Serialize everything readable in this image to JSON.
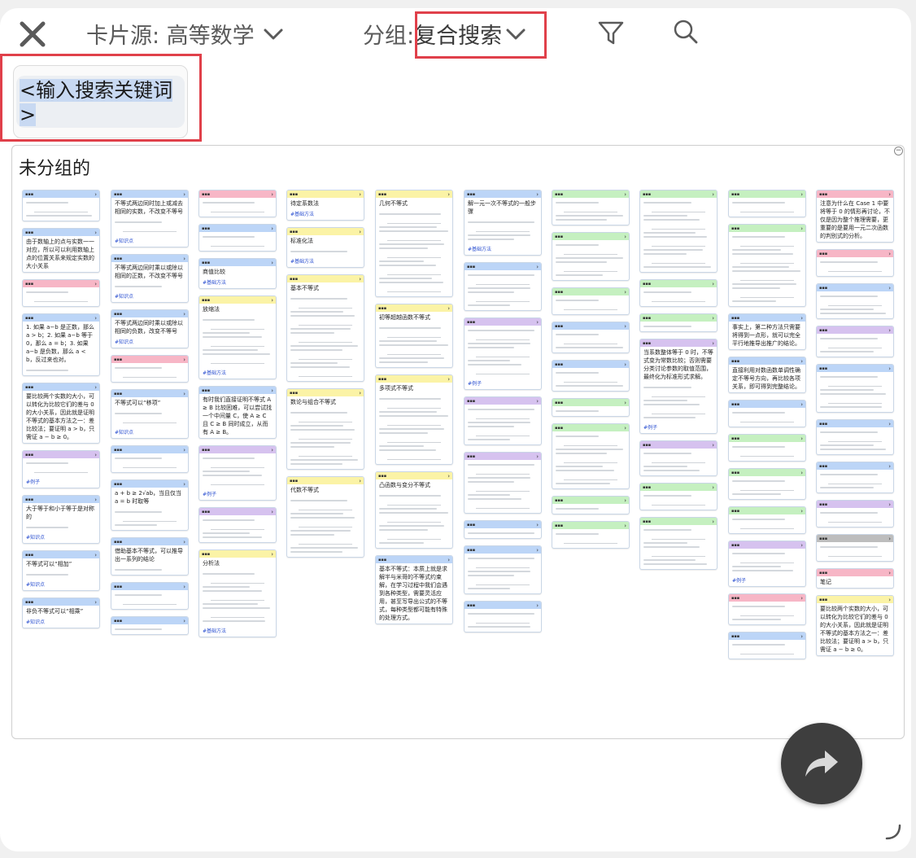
{
  "toolbar": {
    "source_label": "卡片源: 高等数学",
    "group_label": "分组:",
    "group_value": "复合搜索"
  },
  "search": {
    "keyword_placeholder": "<输入搜索关键词>"
  },
  "canvas": {
    "group_title": "未分组的"
  },
  "colors": {
    "blue": "#bcd5f7",
    "pink": "#f7b6c6",
    "yellow": "#fbf3a6",
    "green": "#c5f0c0",
    "purple": "#d6c2ef",
    "gray": "#bdbdbd",
    "accent_red": "#e0404a"
  },
  "columns": [
    {
      "cards": [
        {
          "color": "blue",
          "lines": 3
        },
        {
          "color": "blue",
          "title": "由于数轴上的点与实数一一对应，所以可以利用数轴上点的位置关系来规定实数的大小关系",
          "lines": 0
        },
        {
          "color": "pink",
          "lines": 2
        },
        {
          "color": "blue",
          "title": "1. 如果 a−b 是正数，那么 a > b；2. 如果 a−b 等于 0，那么 a = b；3. 如果 a−b 是负数，那么 a < b，反过来也对。",
          "lines": 1
        },
        {
          "color": "blue",
          "title": "要比较两个实数的大小，可以转化为比较它们的差与 0 的大小关系，因此就是证明不等式的基本方法之一：差比较法；要证明 a > b，只需证 a − b ≥ 0。",
          "tag": "",
          "lines": 0
        },
        {
          "color": "purple",
          "lines": 2,
          "tag": "#例子"
        },
        {
          "color": "blue",
          "title": "大于等于和小于等于是对称的",
          "tag": "#知识点",
          "lines": 1
        },
        {
          "color": "blue",
          "title": "不等式可以“相加”",
          "tag": "#知识点",
          "lines": 1
        },
        {
          "color": "blue",
          "title": "非负不等式可以“相乘”",
          "tag": "#知识点",
          "lines": 0
        }
      ]
    },
    {
      "cards": [
        {
          "color": "blue",
          "title": "不等式两边同时加上或减去相同的实数，不改变不等号",
          "tag": "#知识点",
          "lines": 2
        },
        {
          "color": "blue",
          "title": "不等式两边同时乘以或除以相同的正数，不改变不等号",
          "tag": "#知识点",
          "lines": 1
        },
        {
          "color": "blue",
          "title": "不等式两边同时乘以或除以相同的负数，改变不等号",
          "tag": "#知识点",
          "lines": 0
        },
        {
          "color": "pink",
          "lines": 2
        },
        {
          "color": "blue",
          "title": "不等式可以“移项”",
          "tag": "#知识点",
          "lines": 2
        },
        {
          "color": "blue",
          "lines": 2
        },
        {
          "color": "blue",
          "title": "a + b ≥ 2√ab，当且仅当 a = b 时取等",
          "tag": "",
          "lines": 3
        },
        {
          "color": "blue",
          "title": "借助基本不等式，可以推导出一系列的结论",
          "tag": "",
          "lines": 1
        },
        {
          "color": "blue",
          "lines": 2
        },
        {
          "color": "blue",
          "lines": 1
        }
      ]
    },
    {
      "cards": [
        {
          "color": "pink",
          "lines": 2
        },
        {
          "color": "blue",
          "lines": 2
        },
        {
          "color": "blue",
          "title": "商值比较",
          "tag": "#基础方法",
          "lines": 0
        },
        {
          "color": "yellow",
          "title": "放缩法",
          "tag": "#基础方法",
          "lines": 8
        },
        {
          "color": "blue",
          "title": "有时我们直接证明不等式 A ≥ B 比较困难，可以尝试找一个中间量 C，使 A ≥ C 且 C ≥ B 同时成立，从而有 A ≥ B。",
          "tag": "",
          "lines": 0
        },
        {
          "color": "purple",
          "tag": "#例子",
          "lines": 5
        },
        {
          "color": "purple",
          "lines": 4
        },
        {
          "color": "yellow",
          "title": "分析法",
          "tag": "#基础方法",
          "lines": 9
        }
      ]
    },
    {
      "cards": [
        {
          "color": "yellow",
          "title": "待定系数法",
          "tag": "#基础方法",
          "lines": 0
        },
        {
          "color": "yellow",
          "title": "标准化法",
          "tag": "#基础方法",
          "lines": 1
        },
        {
          "color": "yellow",
          "title": "基本不等式",
          "lines": 14
        },
        {
          "color": "yellow",
          "title": "数论与组合不等式",
          "lines": 10
        },
        {
          "color": "yellow",
          "title": "代数不等式",
          "lines": 10
        }
      ]
    },
    {
      "cards": [
        {
          "color": "yellow",
          "title": "几何不等式",
          "lines": 14
        },
        {
          "color": "yellow",
          "title": "初等超越函数不等式",
          "lines": 7
        },
        {
          "color": "yellow",
          "title": "多项式不等式",
          "lines": 11
        },
        {
          "color": "yellow",
          "title": "凸函数与变分不等式",
          "lines": 9
        },
        {
          "color": "blue",
          "title": "基本不等式：本质上就是求解半与米哥的不等式约束解，在学习过程中我们会遇到各种类型，需要灵活应用，甚至写导出公式的不等式，每种类型都可能有特殊的处理方式。",
          "lines": 0
        }
      ]
    },
    {
      "cards": [
        {
          "color": "blue",
          "title": "解一元一次不等式的一般步骤",
          "tag": "#基础方法",
          "lines": 4
        },
        {
          "color": "blue",
          "lines": 6
        },
        {
          "color": "purple",
          "tag": "#例子",
          "lines": 8
        },
        {
          "color": "purple",
          "lines": 6
        },
        {
          "color": "purple",
          "lines": 8
        },
        {
          "color": "blue",
          "lines": 1
        },
        {
          "color": "blue",
          "lines": 6
        },
        {
          "color": "blue",
          "lines": 3
        }
      ]
    },
    {
      "cards": [
        {
          "color": "green",
          "lines": 4
        },
        {
          "color": "green",
          "lines": 6
        },
        {
          "color": "green",
          "lines": 2
        },
        {
          "color": "blue",
          "lines": 3
        },
        {
          "color": "blue",
          "lines": 3
        },
        {
          "color": "green",
          "lines": 1
        },
        {
          "color": "green",
          "lines": 9
        },
        {
          "color": "green",
          "lines": 1
        },
        {
          "color": "green",
          "lines": 2
        }
      ]
    },
    {
      "cards": [
        {
          "color": "green",
          "lines": 12
        },
        {
          "color": "green",
          "lines": 2
        },
        {
          "color": "green",
          "lines": 1
        },
        {
          "color": "purple",
          "title": "当系数整体等于 0 时，不等式变为常数比较；否则需要分类讨论参数的取值范围，最终化为标准形式求解。",
          "tag": "#例子",
          "lines": 6
        },
        {
          "color": "purple",
          "lines": 4
        },
        {
          "color": "green",
          "lines": 2
        },
        {
          "color": "green",
          "lines": 7
        }
      ]
    },
    {
      "cards": [
        {
          "color": "green",
          "lines": 2
        },
        {
          "color": "green",
          "lines": 12
        },
        {
          "color": "blue",
          "title": "事实上，第二种方法只需要将得到一点形，就可以完全平行地推导出推广的结论。",
          "lines": 0
        },
        {
          "color": "blue",
          "title": "直接利用对数函数单调性确定不等号方向，再比较各项关系，即可得到完整结论。",
          "lines": 0
        },
        {
          "color": "blue",
          "lines": 2
        },
        {
          "color": "green",
          "lines": 2
        },
        {
          "color": "green",
          "lines": 3
        },
        {
          "color": "green",
          "lines": 2
        },
        {
          "color": "purple",
          "tag": "#例子",
          "lines": 4
        },
        {
          "color": "pink",
          "lines": 3
        },
        {
          "color": "blue",
          "lines": 2
        }
      ]
    },
    {
      "cards": [
        {
          "color": "pink",
          "title": "注意为什么在 Case 1 中要将等于 0 的情形再讨论，不仅是因为整个推理需要，更重要的是要用一元二次函数的判别式的分析。",
          "lines": 0
        },
        {
          "color": "pink",
          "lines": 2
        },
        {
          "color": "blue",
          "lines": 4
        },
        {
          "color": "purple",
          "lines": 3
        },
        {
          "color": "blue",
          "lines": 6
        },
        {
          "color": "blue",
          "lines": 4
        },
        {
          "color": "blue",
          "lines": 3
        },
        {
          "color": "purple",
          "lines": 2
        },
        {
          "color": "gray",
          "lines": 2
        },
        {
          "color": "pink",
          "title": "笔记",
          "lines": 0
        },
        {
          "color": "yellow",
          "title": "要比较两个实数的大小，可以转化为比较它们的差与 0 的大小关系，因此就是证明不等式的基本方法之一：差比较法；要证明 a > b，只需证 a − b ≥ 0。",
          "lines": 0
        }
      ]
    }
  ]
}
